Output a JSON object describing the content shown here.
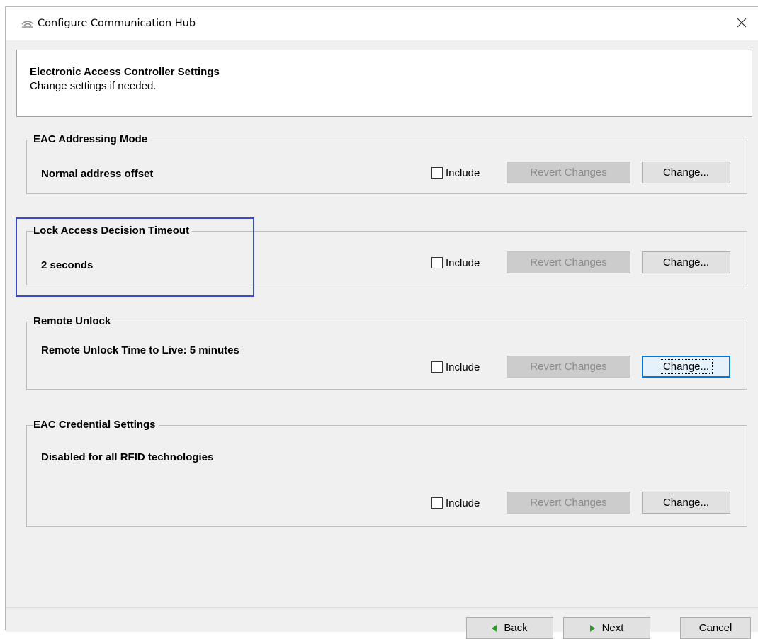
{
  "window": {
    "title": "Configure Communication Hub",
    "app_icon": "communication-hub-icon",
    "close_icon": "close-icon"
  },
  "header": {
    "title": "Electronic Access Controller Settings",
    "subtitle": "Change settings if needed."
  },
  "groups": [
    {
      "legend": "EAC Addressing Mode",
      "value": "Normal address offset",
      "include_label": "Include",
      "include_checked": false,
      "revert_label": "Revert Changes",
      "revert_enabled": false,
      "change_label": "Change...",
      "change_focused": false
    },
    {
      "legend": "Lock Access Decision Timeout",
      "value": "2 seconds",
      "include_label": "Include",
      "include_checked": false,
      "revert_label": "Revert Changes",
      "revert_enabled": false,
      "change_label": "Change...",
      "change_focused": false
    },
    {
      "legend": "Remote Unlock",
      "value": "Remote Unlock Time to Live: 5 minutes",
      "include_label": "Include",
      "include_checked": false,
      "revert_label": "Revert Changes",
      "revert_enabled": false,
      "change_label": "Change...",
      "change_focused": true
    },
    {
      "legend": "EAC Credential Settings",
      "value": "Disabled for all RFID technologies",
      "include_label": "Include",
      "include_checked": false,
      "revert_label": "Revert Changes",
      "revert_enabled": false,
      "change_label": "Change...",
      "change_focused": false
    }
  ],
  "footer": {
    "back_label": "Back",
    "next_label": "Next",
    "cancel_label": "Cancel"
  },
  "colors": {
    "highlight_box": "#3a4bc8",
    "nav_arrow": "#2e9a2e",
    "focus_border": "#0078d7"
  }
}
